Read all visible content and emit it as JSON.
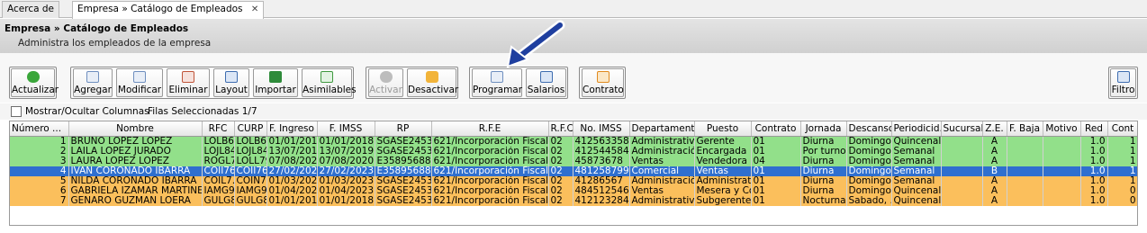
{
  "tabs": [
    {
      "label": "Acerca de",
      "close": ""
    },
    {
      "label": "Empresa » Catálogo de Empleados",
      "close": "✕"
    }
  ],
  "header": {
    "title": "Empresa » Catálogo de Empleados",
    "subtitle": "Administra los empleados de la empresa"
  },
  "toolbar": {
    "actualizar": "Actualizar",
    "agregar": "Agregar",
    "modificar": "Modificar",
    "eliminar": "Eliminar",
    "layout": "Layout",
    "importar": "Importar",
    "asimilables": "Asimilables",
    "activar": "Activar",
    "desactivar": "Desactivar",
    "programar": "Programar",
    "salarios": "Salarios",
    "contrato": "Contrato",
    "filtro": "Filtro"
  },
  "info": {
    "show_columns": "Mostrar/Ocultar Columnas",
    "selected_rows": "Filas Seleccionadas 1/7"
  },
  "columns": [
    "Número ...",
    "Nombre",
    "RFC",
    "CURP",
    "F. Ingreso",
    "F. IMSS",
    "RP",
    "R.F.E",
    "R.F.C",
    "No. IMSS",
    "Departamento",
    "Puesto",
    "Contrato",
    "Jornada",
    "Descanso",
    "Periodicid...",
    "Sucursal",
    "Z.E.",
    "F. Baja",
    "Motivo",
    "Red",
    "Cont"
  ],
  "rows": [
    {
      "status": "green",
      "cells": [
        "1",
        "BRUNO LOPEZ LOPEZ",
        "LOLB6...",
        "LOLB69...",
        "01/01/2018",
        "01/01/2018",
        "SGASE24535",
        "621/Incorporación Fiscal",
        "02",
        "41256335889",
        "Administrativo",
        "Gerente",
        "01",
        "Diurna",
        "Domingo",
        "Quincenal",
        "",
        "A",
        "",
        "",
        "1.0",
        "1"
      ]
    },
    {
      "status": "green",
      "cells": [
        "2",
        "LAILA LOPEZ JURADO",
        "LOJL84...",
        "LOJL84...",
        "13/07/2019",
        "13/07/2019",
        "SGASE24535",
        "621/Incorporación Fiscal",
        "02",
        "412544584",
        "Administració...",
        "Encargada",
        "01",
        "Por turnos",
        "Domingo",
        "Semanal",
        "",
        "A",
        "",
        "",
        "1.0",
        "1"
      ]
    },
    {
      "status": "green",
      "cells": [
        "3",
        "LAURA LOPEZ LOPEZ",
        "ROGL7...",
        "LOLL79...",
        "07/08/2020",
        "07/08/2020",
        "E3589568878",
        "621/Incorporación Fiscal",
        "02",
        "45873678",
        "Ventas",
        "Vendedora",
        "04",
        "Diurna",
        "Domingo",
        "Semanal",
        "",
        "A",
        "",
        "",
        "1.0",
        "1"
      ]
    },
    {
      "status": "selected",
      "cells": [
        "4",
        "IVAN CORONADO IBARRA",
        "COII76...",
        "COII76...",
        "27/02/2023",
        "27/02/2023",
        "E3589568878",
        "621/Incorporación Fiscal",
        "02",
        "4812587992",
        "Comercial",
        "Ventas",
        "01",
        "Diurna",
        "Domingo",
        "Semanal",
        "",
        "B",
        "",
        "",
        "1.0",
        "1"
      ]
    },
    {
      "status": "orange",
      "cells": [
        "5",
        "NILDA CORONADO IBARRA",
        "COIL7...",
        "COIN7...",
        "01/03/2023",
        "01/03/2023",
        "SGASE24535",
        "621/Incorporación Fiscal",
        "02",
        "41286567",
        "Administración",
        "Administrativo",
        "01",
        "Diurna",
        "Domingo",
        "Semanal",
        "",
        "A",
        "",
        "",
        "1.0",
        "1"
      ]
    },
    {
      "status": "orange",
      "cells": [
        "6",
        "GABRIELA IZAMAR MARTINEZ",
        "IAMG9...",
        "IAMG9...",
        "01/04/2023",
        "01/04/2023",
        "SGASE24535",
        "621/Incorporación Fiscal",
        "02",
        "4845125461...",
        "Ventas",
        "Mesera y Coc...",
        "01",
        "Diurna",
        "Domingo",
        "Quincenal",
        "",
        "A",
        "",
        "",
        "1.0",
        "0"
      ]
    },
    {
      "status": "orange",
      "cells": [
        "7",
        "GENARO GUZMAN LOERA",
        "GULG8...",
        "GULG8...",
        "01/01/2018",
        "01/01/2018",
        "SGASE24535",
        "621/Incorporación Fiscal",
        "02",
        "4121232848...",
        "Administrativo",
        "Subgerente",
        "01",
        "Nocturna",
        "Sabado, ...",
        "Quincenal",
        "",
        "A",
        "",
        "",
        "1.0",
        "0"
      ]
    }
  ],
  "colors": {
    "active_row": "#92e08a",
    "inactive_row": "#fbbf5c",
    "selected_row": "#2f6fcf",
    "arrow": "#1f3f9f"
  }
}
